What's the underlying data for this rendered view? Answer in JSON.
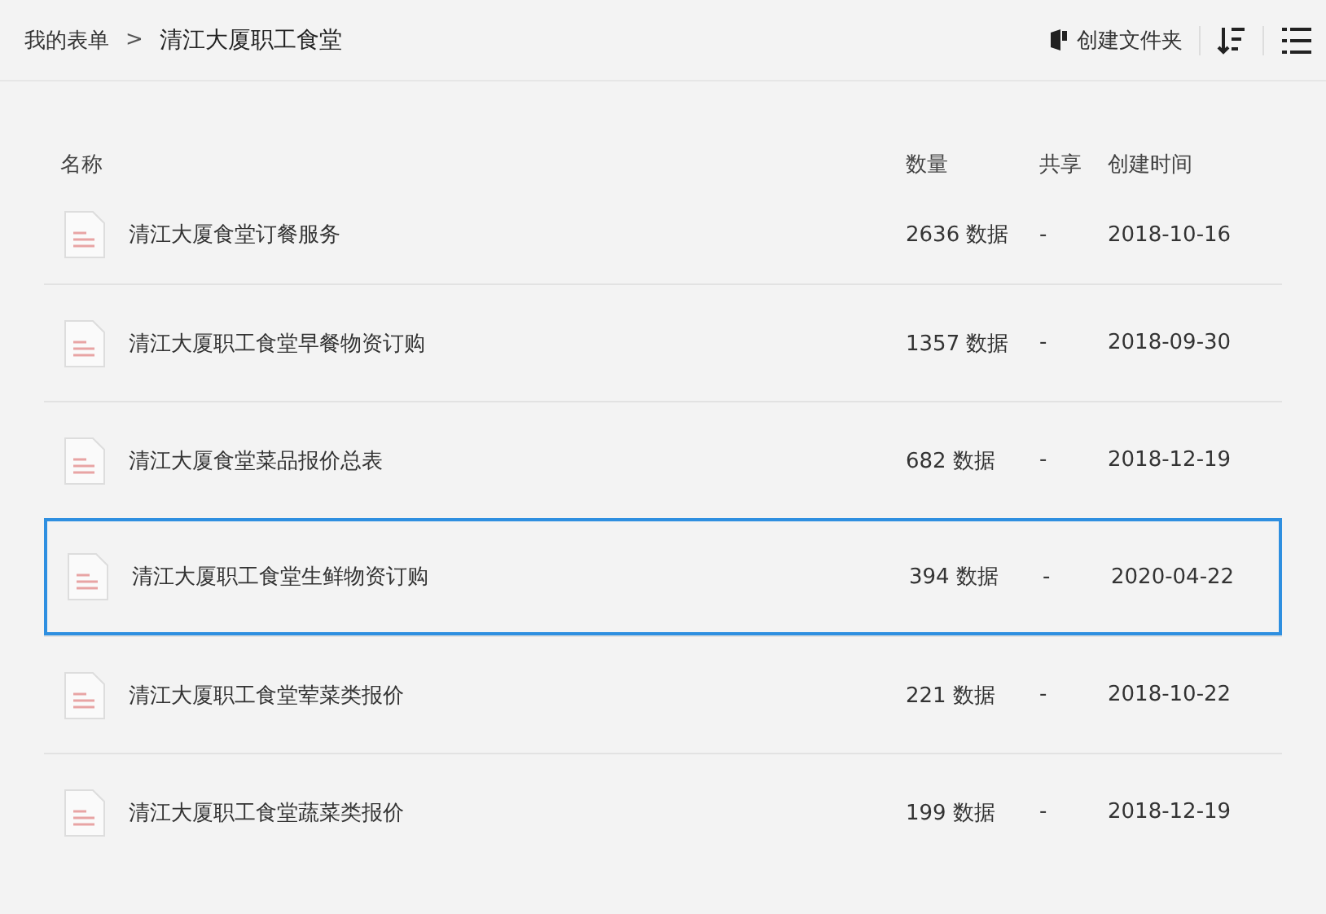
{
  "breadcrumb": {
    "items": [
      "我的表单",
      "清江大厦职工食堂"
    ],
    "separator": ">"
  },
  "toolbar": {
    "create_folder": "创建文件夹"
  },
  "table": {
    "columns": [
      "名称",
      "数量",
      "共享",
      "创建时间"
    ],
    "rows": [
      {
        "name": "清江大厦食堂订餐服务",
        "count": "2636 数据",
        "shared": "-",
        "created": "2018-10-16",
        "selected": false
      },
      {
        "name": "清江大厦职工食堂早餐物资订购",
        "count": "1357 数据",
        "shared": "-",
        "created": "2018-09-30",
        "selected": false
      },
      {
        "name": "清江大厦食堂菜品报价总表",
        "count": "682 数据",
        "shared": "-",
        "created": "2018-12-19",
        "selected": false
      },
      {
        "name": "清江大厦职工食堂生鲜物资订购",
        "count": "394 数据",
        "shared": "-",
        "created": "2020-04-22",
        "selected": true
      },
      {
        "name": "清江大厦职工食堂荤菜类报价",
        "count": "221 数据",
        "shared": "-",
        "created": "2018-10-22",
        "selected": false
      },
      {
        "name": "清江大厦职工食堂蔬菜类报价",
        "count": "199 数据",
        "shared": "-",
        "created": "2018-12-19",
        "selected": false
      }
    ]
  }
}
